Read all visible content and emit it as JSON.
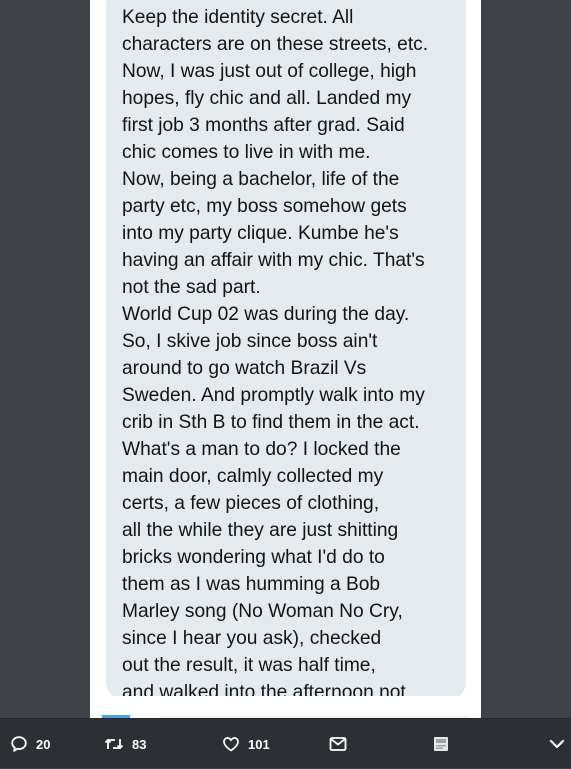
{
  "tweet_image": {
    "lines": [
      "Keep the identity secret. All",
      "characters are on these streets, etc.",
      "Now, I was just out of college, high",
      "hopes, fly chic and all. Landed my",
      "first job 3 months after grad. Said",
      "chic comes to live in with me.",
      "Now, being a bachelor, life of the",
      "party etc, my boss somehow gets",
      "into my party clique. Kumbe he's",
      "having an affair with my chic. That's",
      "not the sad part.",
      "World Cup 02 was during the day.",
      "So, I skive job since boss ain't",
      "around to go watch Brazil Vs",
      "Sweden. And promptly walk into my",
      "crib in Sth B to find them in the act.",
      "What's a man to do? I locked the",
      "main door, calmly collected my",
      "certs, a few pieces of clothing,",
      "all the while they are just shitting",
      "bricks wondering what I'd do to",
      "them as I was humming a Bob",
      "Marley song (No Woman No Cry,",
      "since I hear you ask), checked",
      "out the result, it was half time,",
      "and walked into the afternoon not"
    ]
  },
  "actions": {
    "reply": {
      "icon": "reply-icon",
      "count": "20"
    },
    "retweet": {
      "icon": "retweet-icon",
      "count": "83"
    },
    "like": {
      "icon": "heart-icon",
      "count": "101"
    },
    "message": {
      "icon": "direct-message-icon"
    },
    "media": {
      "icon": "media-icon"
    },
    "next": {
      "icon": "chevron-down-icon"
    }
  },
  "colors": {
    "background": "#3f4349",
    "bubble": "#e4eaee",
    "action_bar": "#2c2f33",
    "accent_blue": "#4aa3df"
  }
}
